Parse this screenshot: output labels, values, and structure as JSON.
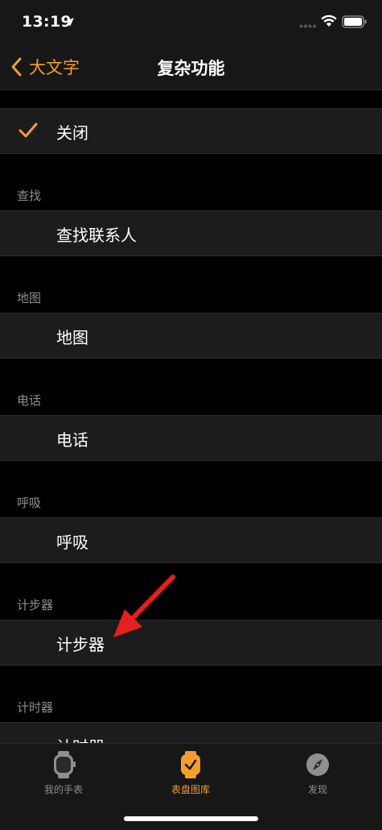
{
  "status_bar": {
    "time": "13:19",
    "icons": [
      "location-arrow-icon",
      "signal-dots-icon",
      "wifi-icon",
      "battery-icon"
    ]
  },
  "nav": {
    "back_label": "大文字",
    "title": "复杂功能"
  },
  "accent_color": "#F49E2A",
  "selected_item": {
    "label": "关闭",
    "icon": "checkmark-icon"
  },
  "sections": [
    {
      "header": "查找",
      "item": "查找联系人"
    },
    {
      "header": "地图",
      "item": "地图"
    },
    {
      "header": "电话",
      "item": "电话"
    },
    {
      "header": "呼吸",
      "item": "呼吸"
    },
    {
      "header": "计步器",
      "item": "计步器"
    },
    {
      "header": "计时器",
      "item": "计时器"
    }
  ],
  "tab_bar": {
    "tabs": [
      {
        "label": "我的手表",
        "icon": "watch-icon",
        "active": false
      },
      {
        "label": "表盘图库",
        "icon": "watch-face-gallery-icon",
        "active": true
      },
      {
        "label": "发现",
        "icon": "compass-icon",
        "active": false
      }
    ]
  }
}
